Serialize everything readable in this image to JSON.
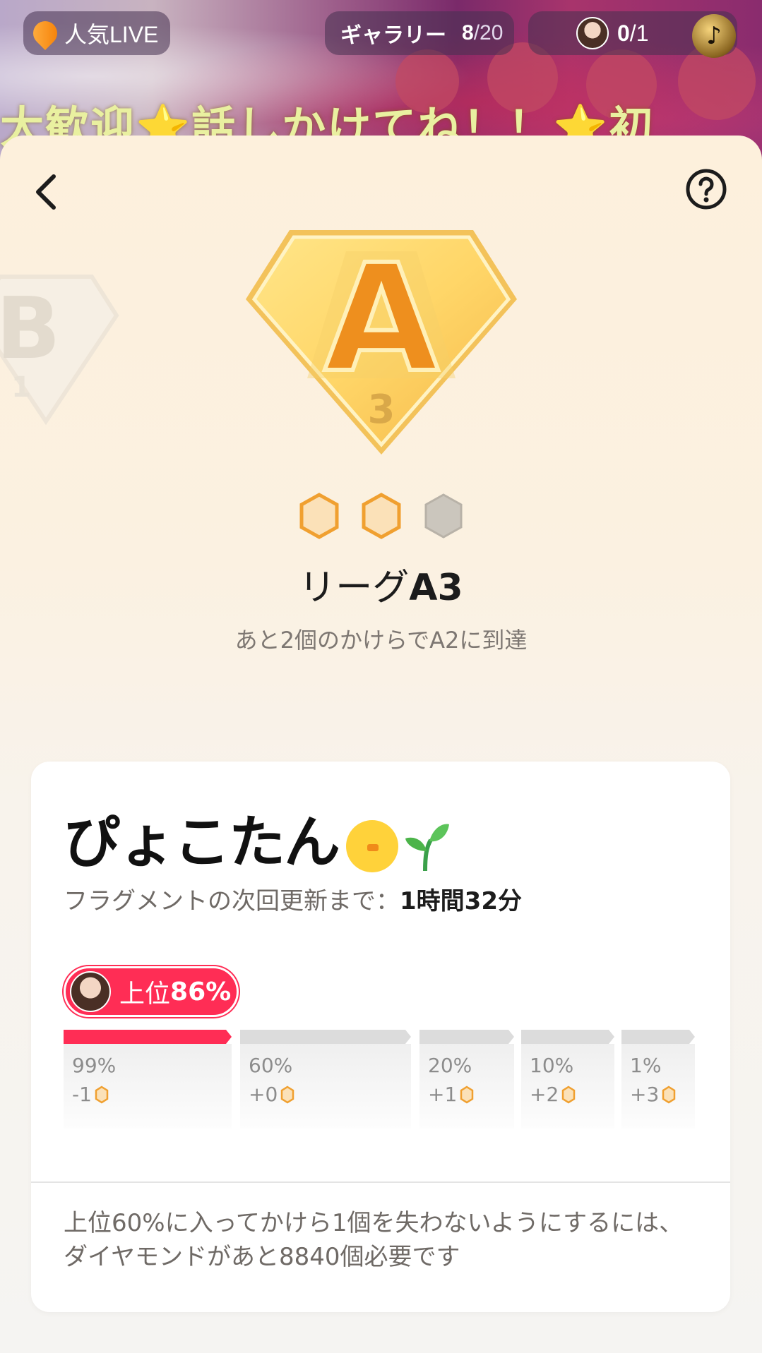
{
  "top_bar": {
    "live_label": "人気LIVE",
    "gallery_label": "ギャラリー",
    "gallery_count": "8",
    "gallery_total": "/20",
    "fans_count": "0",
    "fans_total": "/1",
    "marquee_text": "大歓迎⭐話しかけてね！！⭐初"
  },
  "league": {
    "current_badge_letter": "A",
    "current_badge_level": "3",
    "prev_badge_letter": "B",
    "prev_badge_level": "1",
    "title_prefix": "リーグ",
    "title_rank": "A3",
    "fragments_filled": 2,
    "fragments_total": 3,
    "subtitle": "あと2個のかけらでA2に到達"
  },
  "card": {
    "user_name": "ぴょこたん",
    "next_update_label": "フラグメントの次回更新まで：",
    "next_update_time": "1時間32分",
    "rank_label_prefix": "上位",
    "rank_label_value": "86%",
    "tiers": [
      {
        "pct": "99%",
        "delta": "-1"
      },
      {
        "pct": "60%",
        "delta": "+0"
      },
      {
        "pct": "20%",
        "delta": "+1"
      },
      {
        "pct": "10%",
        "delta": "+2"
      },
      {
        "pct": "1%",
        "delta": "+3"
      }
    ],
    "hint": "上位60%に入ってかけら1個を失わないようにするには、ダイヤモンドがあと8840個必要です"
  },
  "colors": {
    "accent_red": "#ff2d55",
    "gold": "#f0a030",
    "fragment_empty": "#c9c5be"
  }
}
